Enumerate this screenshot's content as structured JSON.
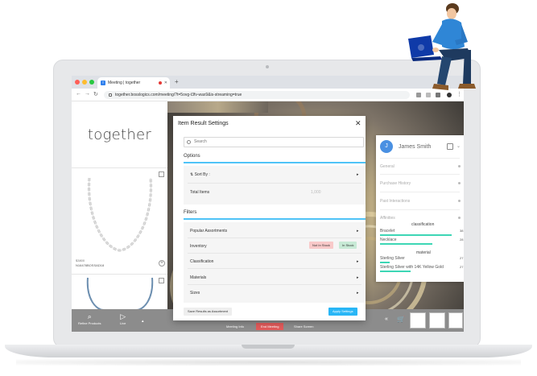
{
  "browser": {
    "tab_title": "Meeting | together",
    "tab_favicon": "T",
    "new_tab": "+",
    "url": "together.bosslogics.com/meeting/?t=5ovg-t3fv-wax9&is-streaming=true"
  },
  "app": {
    "logo": "together",
    "products": [
      {
        "price": "$3800",
        "sku": "N16478BOSSAD18"
      }
    ],
    "bottom_bar": {
      "refine_label": "Refine Products",
      "live_label": "Live",
      "meeting_info": "Meeting Info",
      "end_meeting": "End Meeting",
      "share_screen": "Share Screen"
    }
  },
  "customer_panel": {
    "avatar_initial": "J",
    "name": "James Smith",
    "sections": [
      "General",
      "Purchase History",
      "Past Interactions",
      "Affinities"
    ],
    "affinities": {
      "classification_heading": "classification",
      "classification": [
        {
          "label": "Bracelet",
          "value": "38",
          "fill": 0.93
        },
        {
          "label": "Necklace",
          "value": "28",
          "fill": 0.68
        }
      ],
      "material_heading": "material",
      "material": [
        {
          "label": "Sterling Silver",
          "value": "27",
          "fill": 0.12
        },
        {
          "label": "Sterling Silver with 14K Yellow Gold",
          "value": "27",
          "fill": 0.4
        }
      ]
    }
  },
  "modal": {
    "title": "Item Result Settings",
    "search_placeholder": "Search",
    "options_heading": "Options",
    "sort_by_label": "Sort By :",
    "total_items_label": "Total Items",
    "total_items_value": "1,000",
    "filters_heading": "Filters",
    "filters": {
      "popular": "Popular Assortments",
      "inventory": "Inventory",
      "not_in_stock": "Not In Stock",
      "in_stock": "In Stock",
      "classification": "Classification",
      "materials": "Materials",
      "sizes": "Sizes"
    },
    "save_button": "Save Results as Assortment",
    "apply_button": "Apply Settings"
  },
  "colors": {
    "accent": "#29b6f6",
    "affinity_bar": "#3dd6b5",
    "end_meeting": "#e05a5a",
    "person_shirt": "#2f86d6",
    "laptop_icon": "#0f3aa8"
  }
}
